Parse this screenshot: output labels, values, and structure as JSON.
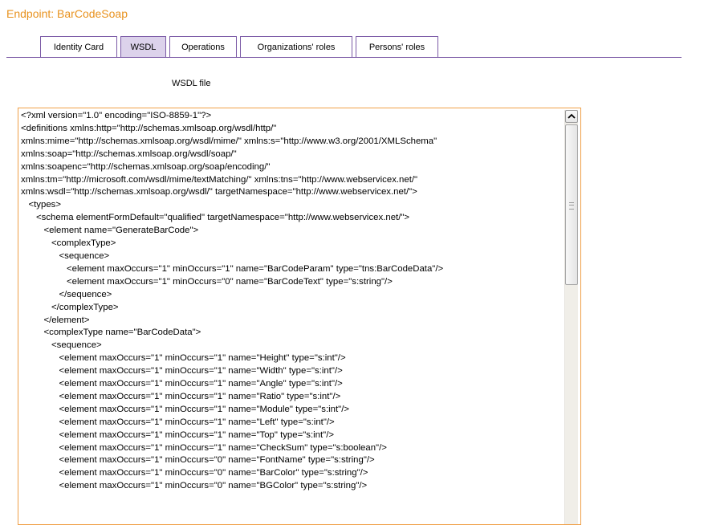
{
  "header": {
    "endpoint_title": "Endpoint: BarCodeSoap"
  },
  "tabs": [
    {
      "label": "Identity Card",
      "active": false
    },
    {
      "label": "WSDL",
      "active": true
    },
    {
      "label": "Operations",
      "active": false
    },
    {
      "label": "Organizations' roles",
      "active": false
    },
    {
      "label": "Persons' roles",
      "active": false
    }
  ],
  "wsdl": {
    "label": "WSDL file",
    "content": "<?xml version=\"1.0\" encoding=\"ISO-8859-1\"?>\n<definitions xmlns:http=\"http://schemas.xmlsoap.org/wsdl/http/\"\nxmlns:mime=\"http://schemas.xmlsoap.org/wsdl/mime/\" xmlns:s=\"http://www.w3.org/2001/XMLSchema\"\nxmlns:soap=\"http://schemas.xmlsoap.org/wsdl/soap/\"\nxmlns:soapenc=\"http://schemas.xmlsoap.org/soap/encoding/\"\nxmlns:tm=\"http://microsoft.com/wsdl/mime/textMatching/\" xmlns:tns=\"http://www.webservicex.net/\"\nxmlns:wsdl=\"http://schemas.xmlsoap.org/wsdl/\" targetNamespace=\"http://www.webservicex.net/\">\n   <types>\n      <schema elementFormDefault=\"qualified\" targetNamespace=\"http://www.webservicex.net/\">\n         <element name=\"GenerateBarCode\">\n            <complexType>\n               <sequence>\n                  <element maxOccurs=\"1\" minOccurs=\"1\" name=\"BarCodeParam\" type=\"tns:BarCodeData\"/>\n                  <element maxOccurs=\"1\" minOccurs=\"0\" name=\"BarCodeText\" type=\"s:string\"/>\n               </sequence>\n            </complexType>\n         </element>\n         <complexType name=\"BarCodeData\">\n            <sequence>\n               <element maxOccurs=\"1\" minOccurs=\"1\" name=\"Height\" type=\"s:int\"/>\n               <element maxOccurs=\"1\" minOccurs=\"1\" name=\"Width\" type=\"s:int\"/>\n               <element maxOccurs=\"1\" minOccurs=\"1\" name=\"Angle\" type=\"s:int\"/>\n               <element maxOccurs=\"1\" minOccurs=\"1\" name=\"Ratio\" type=\"s:int\"/>\n               <element maxOccurs=\"1\" minOccurs=\"1\" name=\"Module\" type=\"s:int\"/>\n               <element maxOccurs=\"1\" minOccurs=\"1\" name=\"Left\" type=\"s:int\"/>\n               <element maxOccurs=\"1\" minOccurs=\"1\" name=\"Top\" type=\"s:int\"/>\n               <element maxOccurs=\"1\" minOccurs=\"1\" name=\"CheckSum\" type=\"s:boolean\"/>\n               <element maxOccurs=\"1\" minOccurs=\"0\" name=\"FontName\" type=\"s:string\"/>\n               <element maxOccurs=\"1\" minOccurs=\"0\" name=\"BarColor\" type=\"s:string\"/>\n               <element maxOccurs=\"1\" minOccurs=\"0\" name=\"BGColor\" type=\"s:string\"/>"
  },
  "scrollbar": {
    "up_icon": "chevron-up-icon",
    "position": 0
  },
  "colors": {
    "title": "#e8921e",
    "tab_border": "#7b5aa6",
    "active_tab_bg": "#dcd2eb",
    "box_border": "#f0a048"
  }
}
